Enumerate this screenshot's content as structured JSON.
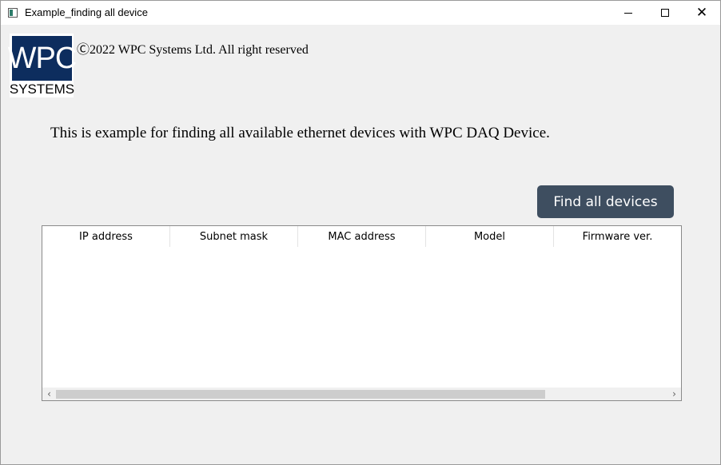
{
  "window": {
    "title": "Example_finding all device",
    "controls": {
      "minimize": "minimize",
      "maximize": "maximize",
      "close": "✕"
    }
  },
  "logo": {
    "top_text": "WPC",
    "bottom_text": "SYSTEMS",
    "brand_color": "#0d2d5e"
  },
  "copyright": "Ⓒ2022 WPC Systems Ltd. All right reserved",
  "description": "This is example for finding all available ethernet devices with WPC DAQ Device.",
  "find_button": {
    "label": "Find all devices",
    "color": "#3e4e60"
  },
  "table": {
    "columns": [
      "IP address",
      "Subnet mask",
      "MAC address",
      "Model",
      "Firmware ver."
    ],
    "rows": []
  },
  "icons": {
    "scroll_left": "‹",
    "scroll_right": "›"
  }
}
